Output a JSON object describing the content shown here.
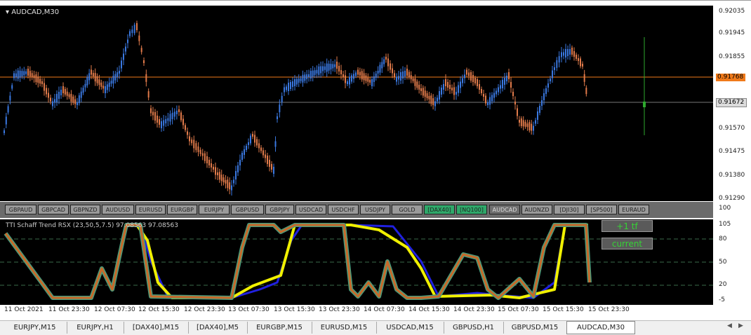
{
  "chart": {
    "symbol_title": "AUDCAD,M30",
    "price_labels": [
      "0.92035",
      "0.91945",
      "0.91855",
      "0.91768",
      "0.91672",
      "0.91570",
      "0.91475",
      "0.91380",
      "0.91290"
    ],
    "current_price_orange": "0.91768",
    "current_price_gray": "0.91672"
  },
  "symbol_buttons": [
    {
      "label": "GBPAUD",
      "state": "normal"
    },
    {
      "label": "GBPCAD",
      "state": "normal"
    },
    {
      "label": "GBPNZD",
      "state": "normal"
    },
    {
      "label": "AUDUSD",
      "state": "normal"
    },
    {
      "label": "EURUSD",
      "state": "normal"
    },
    {
      "label": "EURGBP",
      "state": "normal"
    },
    {
      "label": "EURJPY",
      "state": "normal"
    },
    {
      "label": "GBPUSD",
      "state": "normal"
    },
    {
      "label": "GBPJPY",
      "state": "normal"
    },
    {
      "label": "USDCAD",
      "state": "normal"
    },
    {
      "label": "USDCHF",
      "state": "normal"
    },
    {
      "label": "USDJPY",
      "state": "normal"
    },
    {
      "label": "GOLD",
      "state": "normal"
    },
    {
      "label": "[DAX40]",
      "state": "active"
    },
    {
      "label": "[NQ100]",
      "state": "active"
    },
    {
      "label": "AUDCAD",
      "state": "current"
    },
    {
      "label": "AUDNZD",
      "state": "normal"
    },
    {
      "label": "[DJI30]",
      "state": "normal"
    },
    {
      "label": "[SP500]",
      "state": "normal"
    },
    {
      "label": "EURAUD",
      "state": "normal"
    }
  ],
  "indicator": {
    "title": "TTI Schaff Trend RSX (23,50,5,7.5) 97.08563 97.08563",
    "levels": [
      "105",
      "80",
      "50",
      "20",
      "-5"
    ],
    "top_axis": "100",
    "btn_tf": "+1 tf",
    "btn_current": "current"
  },
  "time_labels": [
    "11 Oct 2021",
    "11 Oct 23:30",
    "12 Oct 07:30",
    "12 Oct 15:30",
    "12 Oct 23:30",
    "13 Oct 07:30",
    "13 Oct 15:30",
    "13 Oct 23:30",
    "14 Oct 07:30",
    "14 Oct 15:30",
    "14 Oct 23:30",
    "15 Oct 07:30",
    "15 Oct 15:30",
    "15 Oct 23:30"
  ],
  "tabs": [
    "EURJPY,M15",
    "EURJPY,H1",
    "[DAX40],M15",
    "[DAX40],M5",
    "EURGBP,M15",
    "EURUSD,M15",
    "USDCAD,M15",
    "GBPUSD,H1",
    "GBPUSD,M15",
    "AUDCAD,M30"
  ],
  "active_tab": "AUDCAD,M30",
  "colors": {
    "bull": "#3a78e0",
    "bear": "#e07a4a",
    "orange_line": "#f07a1a",
    "green": "#2fa86a",
    "yellow": "#f0f000",
    "blue": "#2020e0",
    "brown": "#c86a2a",
    "teal": "#4a9a7a"
  }
}
